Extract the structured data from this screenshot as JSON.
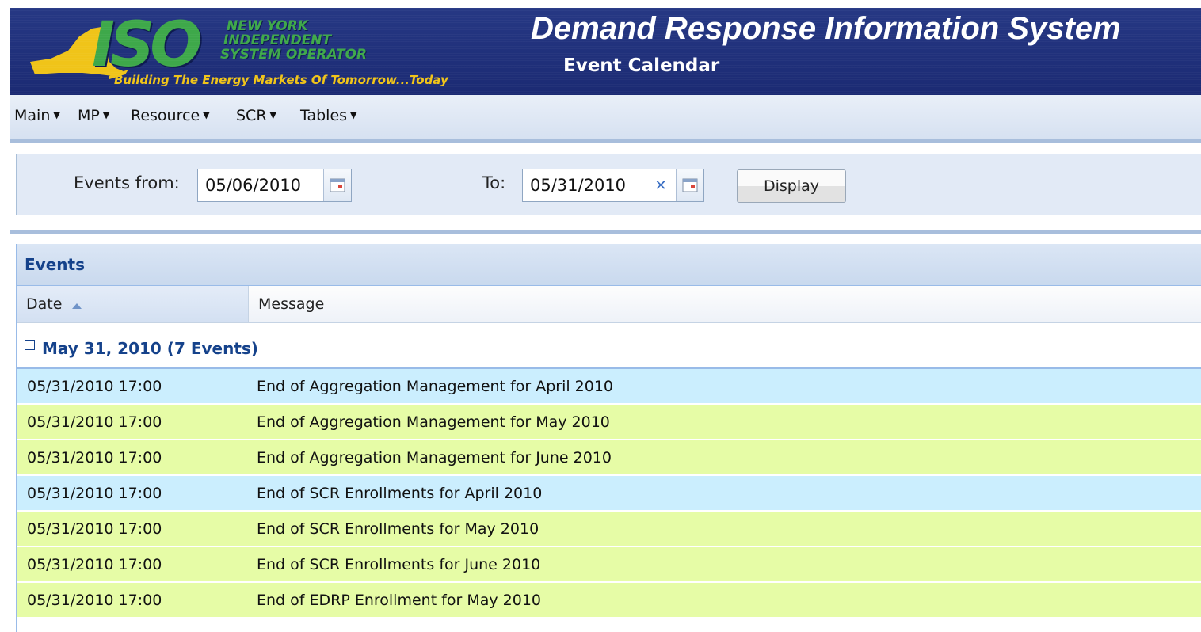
{
  "header": {
    "logo_text": "ISO",
    "logo_lines": [
      "NEW YORK",
      "INDEPENDENT",
      "SYSTEM OPERATOR"
    ],
    "tagline": "Building The Energy Markets Of Tomorrow...Today",
    "app_title": "Demand Response Information System",
    "page_subtitle": "Event Calendar"
  },
  "menu": {
    "items": [
      "Main",
      "MP",
      "Resource",
      "SCR",
      "Tables"
    ]
  },
  "filter": {
    "from_label": "Events from:",
    "from_value": "05/06/2010",
    "to_label": "To:",
    "to_value": "05/31/2010",
    "display_label": "Display"
  },
  "grid": {
    "title": "Events",
    "columns": [
      "Date",
      "Message"
    ],
    "sort": "Date ascending",
    "group_label": "May 31, 2010 (7 Events)",
    "rows": [
      {
        "date": "05/31/2010 17:00",
        "message": "End of Aggregation Management for April 2010",
        "color": "#cbeefe"
      },
      {
        "date": "05/31/2010 17:00",
        "message": "End of Aggregation Management for May 2010",
        "color": "#e6fca6"
      },
      {
        "date": "05/31/2010 17:00",
        "message": "End of Aggregation Management for June 2010",
        "color": "#e6fca6"
      },
      {
        "date": "05/31/2010 17:00",
        "message": "End of SCR Enrollments for April 2010",
        "color": "#cbeefe"
      },
      {
        "date": "05/31/2010 17:00",
        "message": "End of SCR Enrollments for May 2010",
        "color": "#e6fca6"
      },
      {
        "date": "05/31/2010 17:00",
        "message": "End of SCR Enrollments for June 2010",
        "color": "#e6fca6"
      },
      {
        "date": "05/31/2010 17:00",
        "message": "End of EDRP Enrollment for May 2010",
        "color": "#e6fca6"
      }
    ]
  },
  "colors": {
    "header_bg": "#1b2a73",
    "logo_green": "#3ea84a",
    "tagline_yellow": "#f0c419",
    "group_text": "#15428b"
  },
  "icons": [
    "new-york-state-map-icon",
    "calendar-icon",
    "clear-icon",
    "sort-ascending-icon",
    "collapse-group-icon",
    "dropdown-caret-icon"
  ]
}
